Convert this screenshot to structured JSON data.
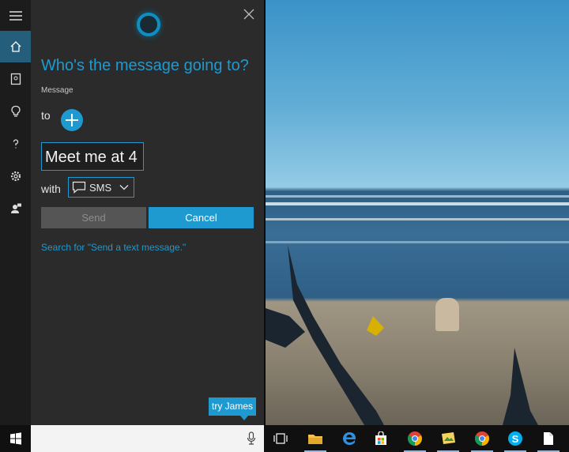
{
  "cortana": {
    "title": "Who's the message going to?",
    "section_label": "Message",
    "to_label": "to",
    "message_value": "Meet me at 4",
    "with_label": "with",
    "app_option": "SMS",
    "send_label": "Send",
    "cancel_label": "Cancel",
    "search_link": "Search for \"Send a text message.\"",
    "try_hint": "try James"
  },
  "rail": [
    "menu-icon",
    "home-icon",
    "notebook-icon",
    "lightbulb-icon",
    "help-icon",
    "settings-icon",
    "feedback-icon"
  ],
  "taskbar": {
    "icons": [
      "start-icon",
      "microphone-icon",
      "task-view-icon",
      "file-explorer-icon",
      "edge-icon",
      "store-icon",
      "chrome-icon",
      "photos-icon",
      "chrome-icon",
      "skype-icon",
      "document-icon"
    ]
  },
  "colors": {
    "accent": "#1e9ad0",
    "panel": "#2b2b2b",
    "rail": "#1c1c1c",
    "taskbar": "#101010"
  }
}
